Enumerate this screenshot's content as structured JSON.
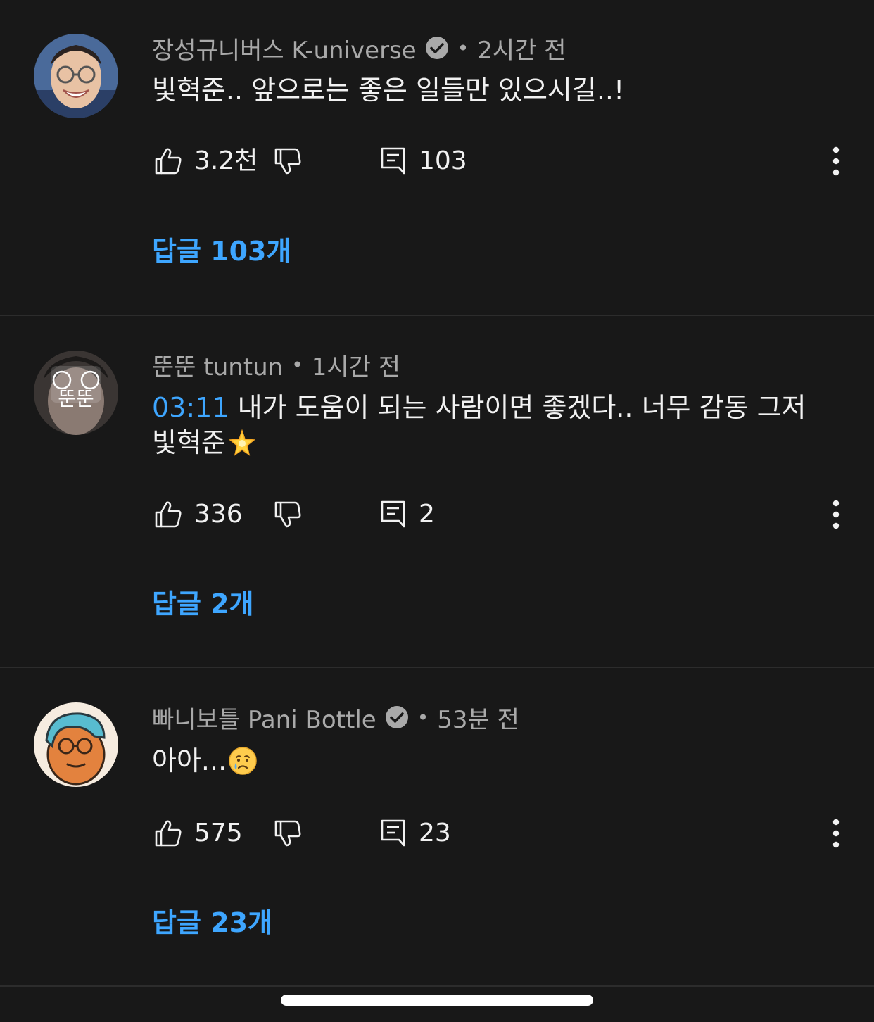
{
  "comments": [
    {
      "author": "장성규니버스 K-universe",
      "verified": true,
      "time": "2시간 전",
      "text": "빛혁준.. 앞으로는 좋은 일들만 있으시길..!",
      "likes": "3.2천",
      "reply_count": "103",
      "replies_label": "답글 103개"
    },
    {
      "author": "뚠뚠 tuntun",
      "verified": false,
      "time": "1시간 전",
      "timestamp": "03:11",
      "text_line1": " 내가 도움이 되는 사람이면 좋겠다.. 너무 감동 그저",
      "text_line2": "빛혁준",
      "emoji": "glowing-star",
      "likes": "336",
      "reply_count": "2",
      "replies_label": "답글 2개",
      "avatar_text": "뚠뚠"
    },
    {
      "author": "빠니보틀 Pani Bottle",
      "verified": true,
      "time": "53분 전",
      "text": "아아...",
      "emoji": "crying-face",
      "likes": "575",
      "reply_count": "23",
      "replies_label": "답글 23개"
    }
  ],
  "separator": "•",
  "colors": {
    "background": "#181818",
    "link": "#3ea6ff",
    "secondary_text": "#a9a9a9",
    "primary_text": "#f1f1f1"
  }
}
